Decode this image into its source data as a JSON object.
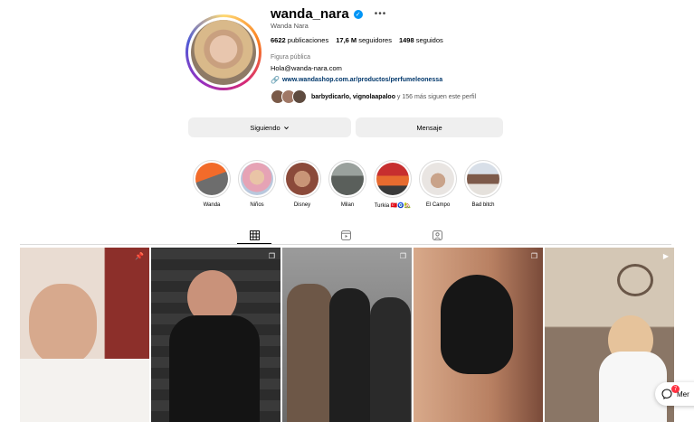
{
  "profile": {
    "username": "wanda_nara",
    "full_name": "Wanda Nara",
    "posts_count": "6622",
    "posts_label": "publicaciones",
    "followers_count": "17,6 M",
    "followers_label": "seguidores",
    "following_count": "1498",
    "following_label": "seguidos",
    "category": "Figura pública",
    "email": "Hola@wanda-nara.com",
    "link": "www.wandashop.com.ar/productos/perfumeleonessa",
    "followed_by_names": "barbydicarlo, vignolaapaloo",
    "followed_by_rest": " y 156 más siguen este perfil"
  },
  "buttons": {
    "following": "Siguiendo",
    "message": "Mensaje"
  },
  "highlights": [
    {
      "label": "Wanda"
    },
    {
      "label": "Niños"
    },
    {
      "label": "Disney"
    },
    {
      "label": "Milan"
    },
    {
      "label": "Turkia 🇹🇷🧿🏡"
    },
    {
      "label": "El Campo"
    },
    {
      "label": "Bad bitch"
    }
  ],
  "tabs": [
    "grid-icon",
    "reels-icon",
    "tagged-icon"
  ],
  "messages": {
    "label": "Mer",
    "badge": "7"
  },
  "colors": {
    "link": "#00376b",
    "verified": "#0095f6",
    "notification": "#ff3040"
  }
}
